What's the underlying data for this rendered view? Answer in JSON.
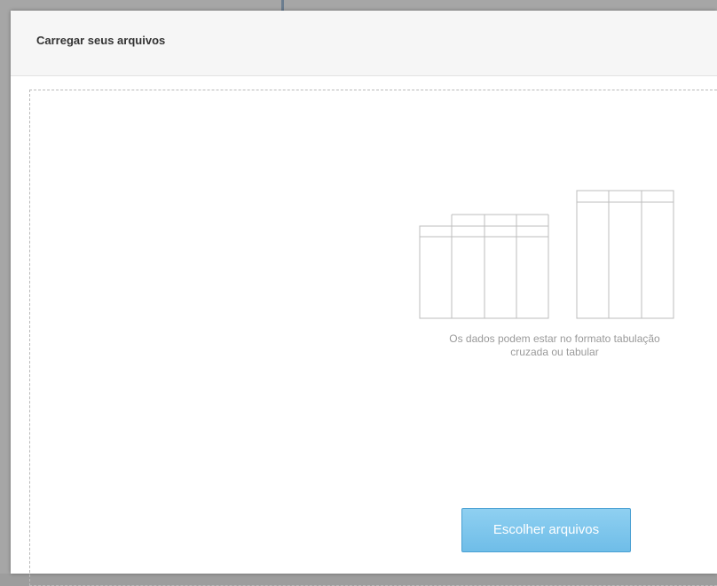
{
  "dialog": {
    "title": "Carregar seus arquivos"
  },
  "dropzone": {
    "illustration_icon": "tables-icon",
    "hint_line1": "Os dados podem estar no formato tabulação",
    "hint_line2": "cruzada ou tabular",
    "choose_button_label": "Escolher arquivos"
  },
  "colors": {
    "button_bg": "#7cc6ee",
    "button_border": "#4aa0d3",
    "hint_text": "#9a9a9a",
    "header_bg": "#f6f6f6"
  }
}
